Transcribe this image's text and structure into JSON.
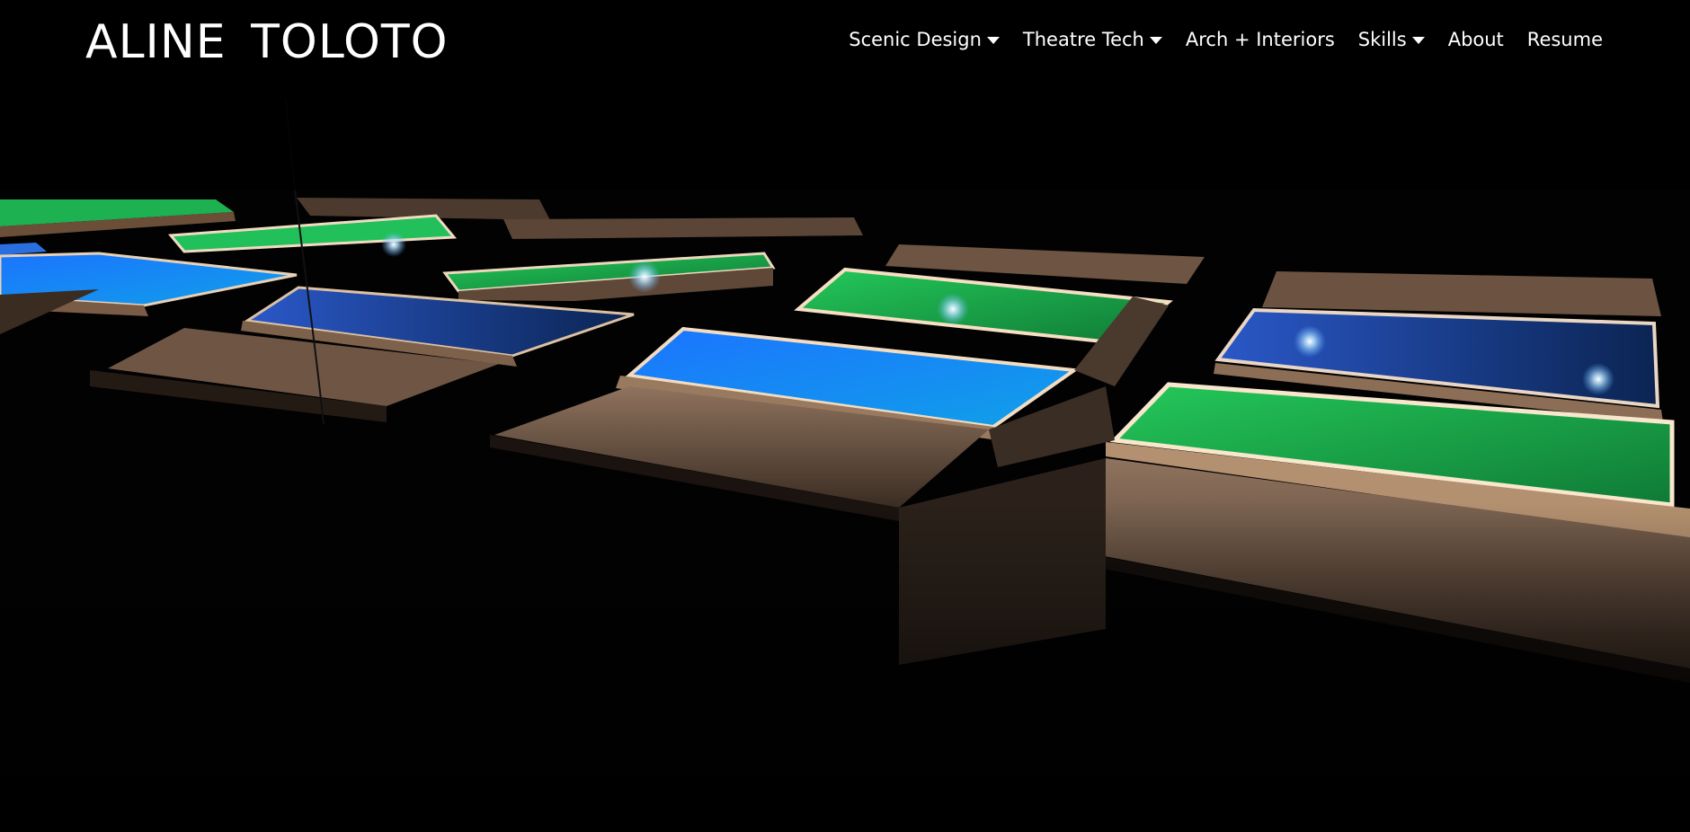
{
  "site": {
    "logo": "ALINE TOLOTO"
  },
  "nav": {
    "items": [
      {
        "label": "Scenic Design",
        "dropdown": true
      },
      {
        "label": "Theatre Tech",
        "dropdown": true
      },
      {
        "label": "Arch + Interiors",
        "dropdown": false
      },
      {
        "label": "Skills",
        "dropdown": true
      },
      {
        "label": "About",
        "dropdown": false
      },
      {
        "label": "Resume",
        "dropdown": false
      }
    ]
  },
  "hero": {
    "image": "dark-stage-light-boxes-photo",
    "colors": {
      "green": "#1fc24f",
      "blue": "#1f7fe6",
      "wood": "#8a6c56",
      "background": "#020203"
    }
  }
}
